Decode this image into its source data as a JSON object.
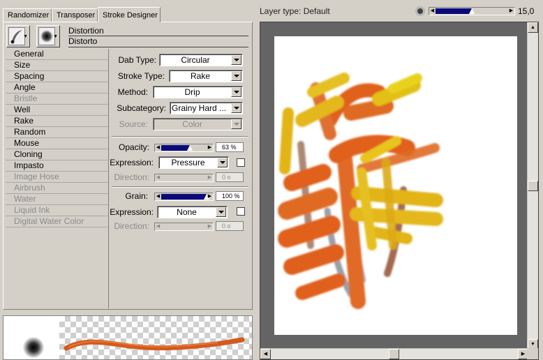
{
  "tabs": [
    {
      "label": "Randomizer",
      "active": false
    },
    {
      "label": "Transposer",
      "active": false
    },
    {
      "label": "Stroke Designer",
      "active": true
    }
  ],
  "variant": {
    "category": "Distortion",
    "name": "Distorto"
  },
  "categories": [
    {
      "label": "General",
      "enabled": true
    },
    {
      "label": "Size",
      "enabled": true
    },
    {
      "label": "Spacing",
      "enabled": true
    },
    {
      "label": "Angle",
      "enabled": true
    },
    {
      "label": "Bristle",
      "enabled": false
    },
    {
      "label": "Well",
      "enabled": true
    },
    {
      "label": "Rake",
      "enabled": true
    },
    {
      "label": "Random",
      "enabled": true
    },
    {
      "label": "Mouse",
      "enabled": true
    },
    {
      "label": "Cloning",
      "enabled": true
    },
    {
      "label": "Impasto",
      "enabled": true
    },
    {
      "label": "Image Hose",
      "enabled": false
    },
    {
      "label": "Airbrush",
      "enabled": false
    },
    {
      "label": "Water",
      "enabled": false
    },
    {
      "label": "Liquid Ink",
      "enabled": false
    },
    {
      "label": "Digital Water Color",
      "enabled": false
    }
  ],
  "general": {
    "dab_type": {
      "label": "Dab Type:",
      "value": "Circular"
    },
    "stroke_type": {
      "label": "Stroke Type:",
      "value": "Rake"
    },
    "method": {
      "label": "Method:",
      "value": "Drip"
    },
    "subcategory": {
      "label": "Subcategory:",
      "value": "Grainy Hard ..."
    },
    "source": {
      "label": "Source:",
      "value": "Color"
    }
  },
  "opacity": {
    "label": "Opacity:",
    "value_text": "63 %",
    "value": 0.63,
    "expression_label": "Expression:",
    "expression": "Pressure",
    "direction_label": "Direction:",
    "direction_value": "0 o"
  },
  "grain": {
    "label": "Grain:",
    "value_text": "100 %",
    "value": 1.0,
    "expression_label": "Expression:",
    "expression": "None",
    "direction_label": "Direction:",
    "direction_value": "0 o"
  },
  "canvas": {
    "layer_type": "Layer type: Default",
    "brush_size_text": "15,0",
    "brush_size_fraction": 0.5
  },
  "colors": {
    "accent_slider": "#0a0a7a",
    "paint_orange": "#e0601c",
    "paint_yellow": "#e2b415",
    "paint_brown": "#9a5a3a",
    "paint_gray": "#8a8f96"
  }
}
